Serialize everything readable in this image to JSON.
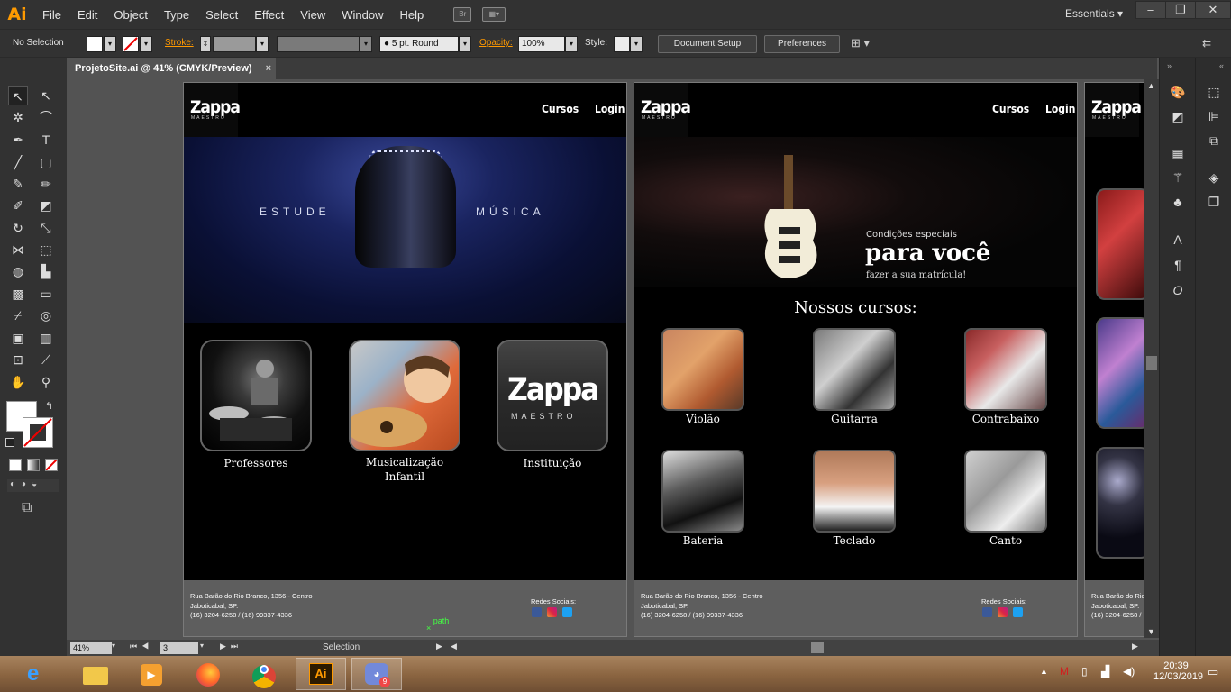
{
  "app": {
    "logo": "Ai",
    "menus": [
      "File",
      "Edit",
      "Object",
      "Type",
      "Select",
      "Effect",
      "View",
      "Window",
      "Help"
    ],
    "bridge_label": "Br",
    "workspace": "Essentials"
  },
  "control_bar": {
    "selection": "No Selection",
    "stroke_label": "Stroke:",
    "brush": "5 pt. Round",
    "opacity_label": "Opacity:",
    "opacity": "100%",
    "style_label": "Style:",
    "document_setup": "Document Setup",
    "preferences": "Preferences"
  },
  "document_tab": {
    "title": "ProjetoSite.ai @ 41% (CMYK/Preview)",
    "close": "×"
  },
  "site": {
    "logo_main": "Zappa",
    "logo_sub": "MAESTRO",
    "nav_courses": "Cursos",
    "nav_login": "Login",
    "footer_address1": "Rua Barão do Rio Branco, 1356 - Centro",
    "footer_address2": "Jaboticabal, SP.",
    "footer_phone": "(16) 3204-6258 / (16) 99337-4336",
    "social_label": "Redes Sociais:"
  },
  "artboard1": {
    "hero_left": "ESTUDE",
    "hero_right": "MÚSICA",
    "card_professores": "Professores",
    "card_musicalizacao_1": "Musicalização",
    "card_musicalizacao_2": "Infantil",
    "card_instituicao": "Instituição",
    "inst_logo_main": "Zappa",
    "inst_logo_sub": "MAESTRO"
  },
  "artboard2": {
    "promo_line1": "Condições especiais",
    "promo_line2": "para você",
    "promo_line3": "fazer a sua matrícula!",
    "courses_title": "Nossos cursos:",
    "courses": [
      "Violão",
      "Guitarra",
      "Contrabaixo",
      "Bateria",
      "Teclado",
      "Canto"
    ]
  },
  "artboard3": {
    "footer_address1": "Rua Barão do Rio",
    "footer_address2": "Jaboticabal, SP.",
    "footer_phone": "(16) 3204-6258 /"
  },
  "canvas_hint": {
    "label": "path"
  },
  "status_bar": {
    "zoom": "41%",
    "artboard_number": "3",
    "tool": "Selection"
  },
  "taskbar": {
    "time": "20:39",
    "date": "12/03/2019",
    "discord_badge": "9",
    "apps": [
      "edge-icon",
      "explorer-icon",
      "media-player-icon",
      "firefox-icon",
      "chrome-icon",
      "illustrator-icon",
      "discord-icon"
    ]
  },
  "colors": {
    "ai_orange": "#ff9a00",
    "chrome_dark": "#323232",
    "canvas_gray": "#535353",
    "artboard_black": "#000000",
    "footer_gray": "#5e5e5e"
  }
}
